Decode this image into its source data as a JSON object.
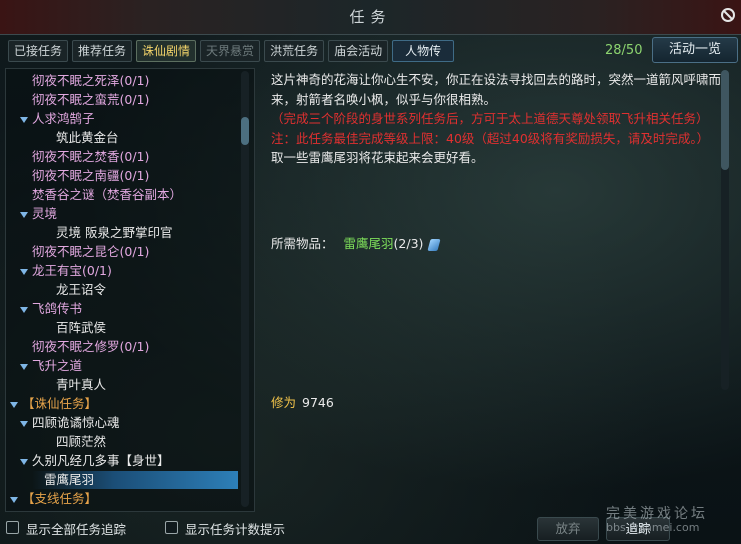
{
  "window": {
    "title": "任务"
  },
  "tabs": [
    {
      "label": "已接任务",
      "state": "normal"
    },
    {
      "label": "推荐任务",
      "state": "normal"
    },
    {
      "label": "诛仙剧情",
      "state": "active"
    },
    {
      "label": "天界悬赏",
      "state": "dim"
    },
    {
      "label": "洪荒任务",
      "state": "normal"
    },
    {
      "label": "庙会活动",
      "state": "normal"
    },
    {
      "label": "人物传",
      "state": "blue"
    }
  ],
  "counter": "28/50",
  "overview_button": "活动一览",
  "quest_list": [
    {
      "label": "彻夜不眠之死泽(0/1)",
      "color": "pink",
      "level": 1,
      "caret": false
    },
    {
      "label": "彻夜不眠之蛮荒(0/1)",
      "color": "pink",
      "level": 1,
      "caret": false
    },
    {
      "label": "人求鸿鹄子",
      "color": "pink",
      "level": 1,
      "caret": true
    },
    {
      "label": "筑此黄金台",
      "color": "white",
      "level": 2,
      "caret": false
    },
    {
      "label": "彻夜不眠之焚香(0/1)",
      "color": "pink",
      "level": 1,
      "caret": false
    },
    {
      "label": "彻夜不眠之南疆(0/1)",
      "color": "pink",
      "level": 1,
      "caret": false
    },
    {
      "label": "焚香谷之谜（焚香谷副本）",
      "color": "pink",
      "level": 1,
      "caret": false
    },
    {
      "label": "灵境",
      "color": "pink",
      "level": 1,
      "caret": true
    },
    {
      "label": "灵境 阪泉之野掌印官",
      "color": "white",
      "level": 2,
      "caret": false
    },
    {
      "label": "彻夜不眠之昆仑(0/1)",
      "color": "pink",
      "level": 1,
      "caret": false
    },
    {
      "label": "龙王有宝(0/1)",
      "color": "pink",
      "level": 1,
      "caret": true
    },
    {
      "label": "龙王诏令",
      "color": "white",
      "level": 2,
      "caret": false
    },
    {
      "label": "飞鸽传书",
      "color": "pink",
      "level": 1,
      "caret": true
    },
    {
      "label": "百阵武侯",
      "color": "white",
      "level": 2,
      "caret": false
    },
    {
      "label": "彻夜不眠之修罗(0/1)",
      "color": "pink",
      "level": 1,
      "caret": false
    },
    {
      "label": "飞升之道",
      "color": "pink",
      "level": 1,
      "caret": true
    },
    {
      "label": "青叶真人",
      "color": "white",
      "level": 2,
      "caret": false
    },
    {
      "label": "【诛仙任务】",
      "color": "orange",
      "level": 0,
      "caret": true
    },
    {
      "label": "四顾诡谲惊心魂",
      "color": "white",
      "level": 1,
      "caret": true
    },
    {
      "label": "四顾茫然",
      "color": "white",
      "level": 2,
      "caret": false
    },
    {
      "label": "久别凡经几多事【身世】",
      "color": "white",
      "level": 1,
      "caret": true
    },
    {
      "label": "雷鹰尾羽",
      "color": "white",
      "level": 2,
      "caret": false,
      "selected": true
    },
    {
      "label": "【支线任务】",
      "color": "orange",
      "level": 0,
      "caret": true
    }
  ],
  "detail": {
    "intro": "这片神奇的花海让你心生不安，你正在设法寻找回去的路时，突然一道箭风呼啸而来，射箭者名唤小枫，似乎与你很相熟。",
    "red_note_1": "（完成三个阶段的身世系列任务后，方可于太上道德天尊处领取飞升相关任务）",
    "red_note_2": "注：此任务最佳完成等级上限：40级（超过40级将有奖励损失，请及时完成。）",
    "objective": "取一些雷鹰尾羽将花束起来会更好看。",
    "required_label": "所需物品：",
    "required_item": "雷鹰尾羽",
    "required_count": "(2/3)",
    "reward_label": "修为",
    "reward_value": "9746"
  },
  "bottom": {
    "check_all_track": "显示全部任务追踪",
    "check_count_tip": "显示任务计数提示",
    "abandon_button": "放弃",
    "track_button": "追踪"
  },
  "watermark": {
    "line1": "完美游戏论坛",
    "line2": "bbs.wanmei.com"
  }
}
